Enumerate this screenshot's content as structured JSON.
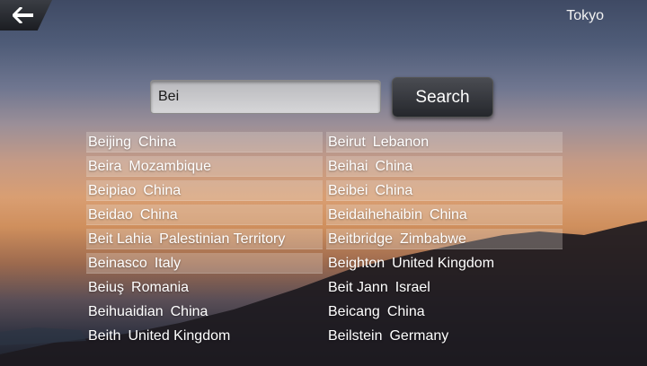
{
  "header": {
    "back_icon": "arrow-left-icon",
    "location": "Tokyo"
  },
  "search": {
    "value": "Bei",
    "button_label": "Search"
  },
  "results": [
    {
      "city": "Beijing",
      "country": "China"
    },
    {
      "city": "Beirut",
      "country": "Lebanon"
    },
    {
      "city": "Beira",
      "country": "Mozambique"
    },
    {
      "city": "Beihai",
      "country": "China"
    },
    {
      "city": "Beipiao",
      "country": "China"
    },
    {
      "city": "Beibei",
      "country": "China"
    },
    {
      "city": "Beidao",
      "country": "China"
    },
    {
      "city": "Beidaihehaibin",
      "country": "China"
    },
    {
      "city": "Beit Lahia",
      "country": "Palestinian Territory"
    },
    {
      "city": "Beitbridge",
      "country": "Zimbabwe"
    },
    {
      "city": "Beinasco",
      "country": "Italy"
    },
    {
      "city": "Beighton",
      "country": "United Kingdom"
    },
    {
      "city": "Beiuş",
      "country": "Romania"
    },
    {
      "city": "Beit Jann",
      "country": "Israel"
    },
    {
      "city": "Beihuaidian",
      "country": "China"
    },
    {
      "city": "Beicang",
      "country": "China"
    },
    {
      "city": "Beith",
      "country": "United Kingdom"
    },
    {
      "city": "Beilstein",
      "country": "Germany"
    }
  ]
}
